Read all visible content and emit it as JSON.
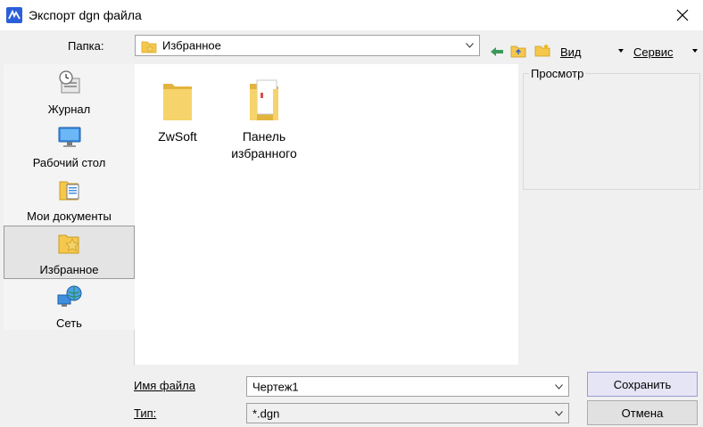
{
  "window": {
    "title": "Экспорт dgn файла"
  },
  "folder": {
    "label": "Папка:",
    "value": "Избранное"
  },
  "toolbar": {
    "view_label": "Вид",
    "service_label": "Сервис"
  },
  "places": {
    "items": [
      {
        "label": "Журнал"
      },
      {
        "label": "Рабочий стол"
      },
      {
        "label": "Мои документы"
      },
      {
        "label": "Избранное"
      },
      {
        "label": "Сеть"
      }
    ]
  },
  "files": [
    {
      "name": "ZwSoft"
    },
    {
      "name": "Панель избранного"
    }
  ],
  "preview": {
    "title": "Просмотр"
  },
  "filename": {
    "label": "Имя файла",
    "value": "Чертеж1"
  },
  "filetype": {
    "label": "Тип:",
    "value": "*.dgn"
  },
  "buttons": {
    "save": "Сохранить",
    "cancel": "Отмена"
  },
  "colors": {
    "folder_yellow": "#f5c84c",
    "accent_blue": "#2b5fd9",
    "primary_button_bg": "#e5e5f5"
  },
  "icons": {
    "app": "zwcad-app-icon",
    "close": "close-icon",
    "back": "back-arrow-icon",
    "up": "folder-up-icon",
    "new_folder": "new-folder-icon"
  }
}
